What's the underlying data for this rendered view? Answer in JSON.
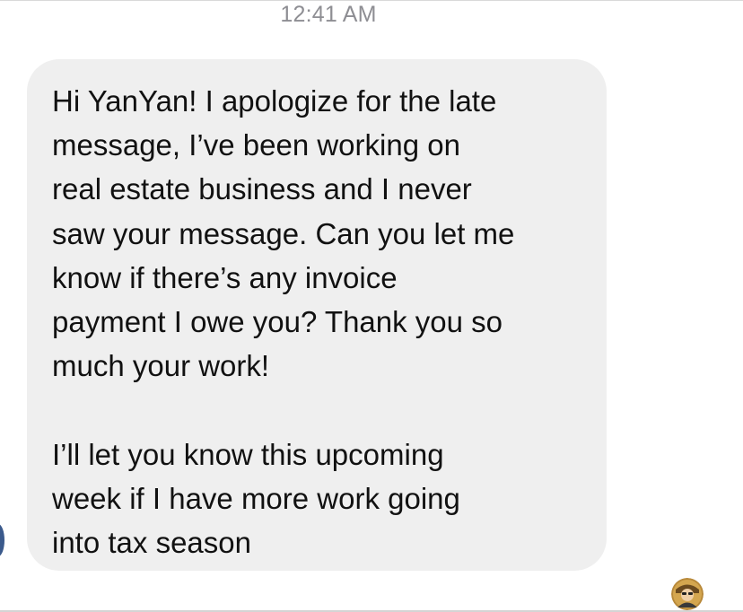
{
  "thread": {
    "timestamp": "12:41 AM"
  },
  "message": {
    "paragraph1": [
      "Hi YanYan! I apologize for the late",
      "message, I’ve been working on",
      "real estate business and I never",
      "saw your message. Can you let me",
      "know if there’s any invoice",
      "payment I owe you? Thank you so",
      "much your work!"
    ],
    "paragraph2": [
      "I’ll let you know this upcoming",
      "week if I have more work going",
      "into tax season"
    ]
  },
  "colors": {
    "bubble_bg": "#efefef",
    "timestamp": "#8e8e93",
    "text": "#111111"
  },
  "icons": {
    "sender_avatar": "avatar-partial",
    "read_receipt": "read-receipt-avatar"
  }
}
